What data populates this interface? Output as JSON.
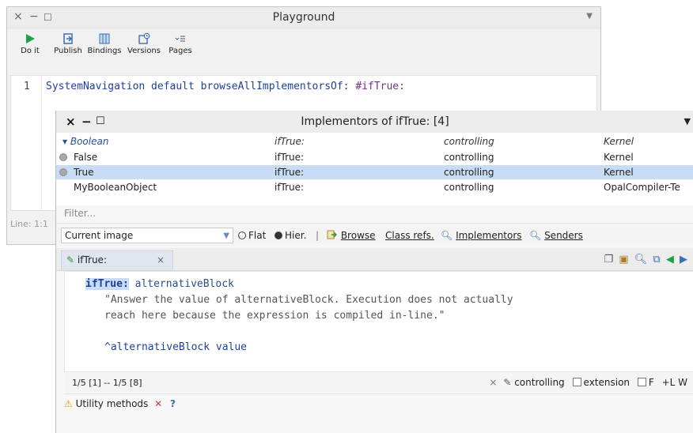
{
  "playground": {
    "title": "Playground",
    "controls": {
      "close": "×",
      "minimize": "−",
      "maximize": "☐"
    },
    "menu_caret": "▼",
    "toolbar": [
      {
        "label": "Do it",
        "icon": "play-icon"
      },
      {
        "label": "Publish",
        "icon": "publish-icon"
      },
      {
        "label": "Bindings",
        "icon": "bindings-icon"
      },
      {
        "label": "Versions",
        "icon": "versions-icon"
      },
      {
        "label": "Pages",
        "icon": "pages-icon"
      }
    ],
    "editor": {
      "line_number": "1",
      "code_main": "SystemNavigation default browseAllImplementorsOf: ",
      "code_symbol": "#ifTrue:"
    },
    "status": "Line: 1:1"
  },
  "implementors": {
    "title": "Implementors of ifTrue: [4]",
    "controls": {
      "close": "×",
      "minimize": "−",
      "maximize": "☐"
    },
    "menu_caret": "▼",
    "header": {
      "class": "▾ Boolean",
      "selector": "ifTrue:",
      "protocol": "controlling",
      "package": "Kernel"
    },
    "rows": [
      {
        "class": "False",
        "selector": "ifTrue:",
        "protocol": "controlling",
        "package": "Kernel"
      },
      {
        "class": "True",
        "selector": "ifTrue:",
        "protocol": "controlling",
        "package": "Kernel"
      },
      {
        "class": "MyBooleanObject",
        "selector": "ifTrue:",
        "protocol": "controlling",
        "package": "OpalCompiler-Te"
      }
    ],
    "filter_placeholder": "Filter...",
    "scope": {
      "selected": "Current image",
      "flat": "Flat",
      "hier": "Hier.",
      "separator": "|",
      "browse": "Browse",
      "class_refs": "Class refs.",
      "implementors": "Implementors",
      "senders": "Senders"
    },
    "tab": {
      "label": "ifTrue:",
      "close": "×"
    },
    "source": {
      "selector": "ifTrue:",
      "arg": " alternativeBlock",
      "comment1": "\"Answer the value of alternativeBlock. Execution does not actually",
      "comment2": "reach here because the expression is compiled in-line.\"",
      "return": "^alternativeBlock value"
    },
    "status": {
      "position": "1/5 [1] -- 1/5 [8]",
      "close_x": "×",
      "protocol": "controlling",
      "extension": "extension",
      "f": "F",
      "lw": "+L W"
    },
    "bottom": {
      "label": "Utility methods",
      "x": "✕",
      "help": "?"
    }
  },
  "colors": {
    "selection": "#c9dcf5",
    "accent_green": "#1aa34a",
    "warning": "#e0a000",
    "error": "#d93a3a"
  }
}
